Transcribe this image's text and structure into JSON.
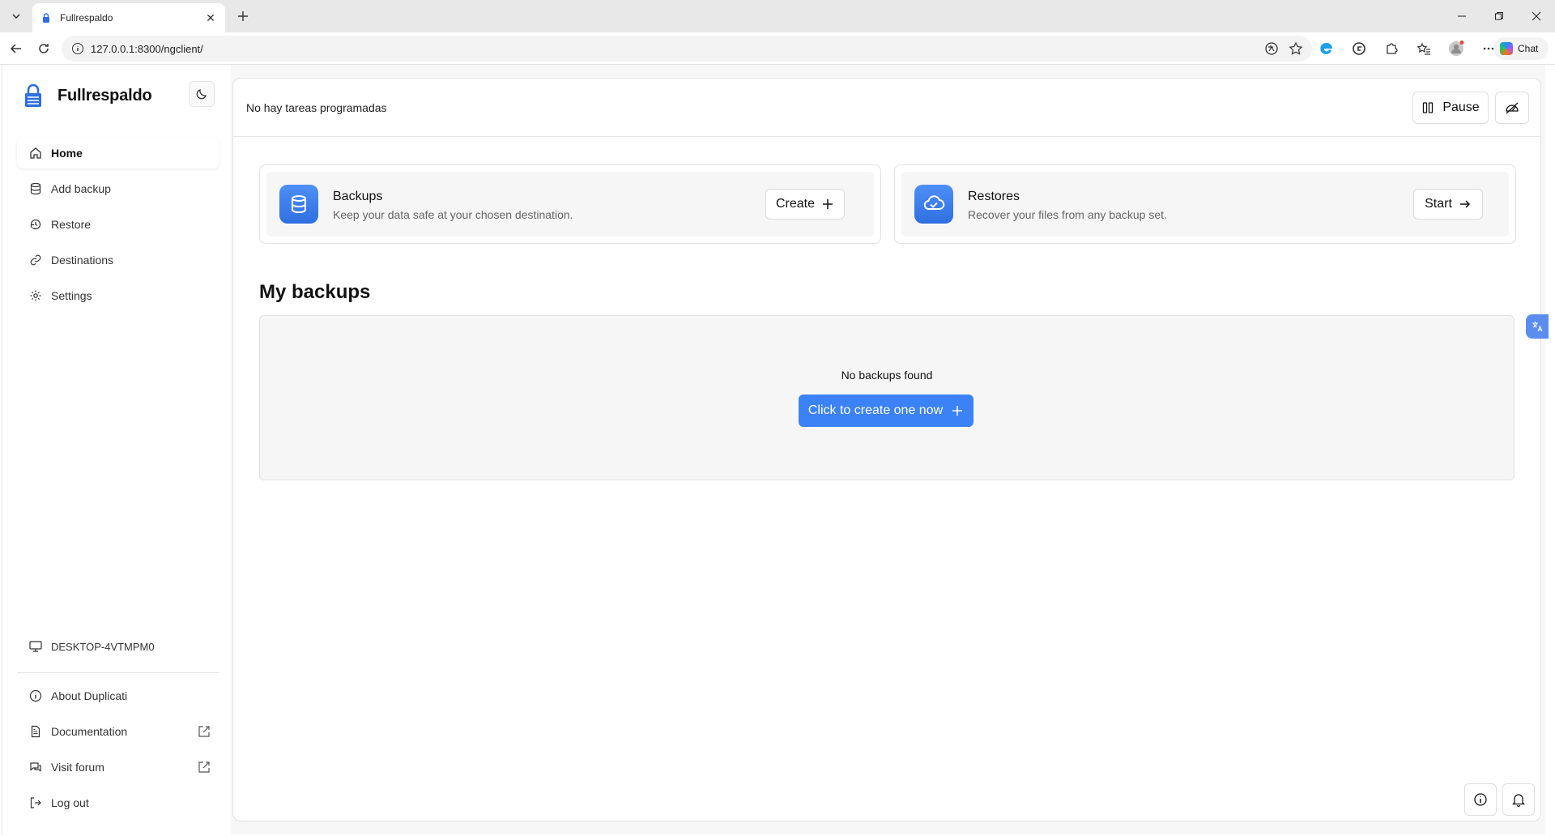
{
  "browser": {
    "tab_title": "Fullrespaldo",
    "url": "127.0.0.1:8300/ngclient/",
    "chat_label": "Chat"
  },
  "sidebar": {
    "brand": "Fullrespaldo",
    "items": [
      {
        "label": "Home",
        "icon": "home-icon"
      },
      {
        "label": "Add backup",
        "icon": "database-icon"
      },
      {
        "label": "Restore",
        "icon": "history-icon"
      },
      {
        "label": "Destinations",
        "icon": "link-icon"
      },
      {
        "label": "Settings",
        "icon": "gear-icon"
      }
    ],
    "machine_name": "DESKTOP-4VTMPM0",
    "bottom_items": [
      {
        "label": "About Duplicati",
        "icon": "info-icon"
      },
      {
        "label": "Documentation",
        "icon": "document-icon"
      },
      {
        "label": "Visit forum",
        "icon": "chat-icon"
      },
      {
        "label": "Log out",
        "icon": "logout-icon"
      }
    ]
  },
  "topbar": {
    "schedule_status": "No hay tareas programadas",
    "pause_label": "Pause"
  },
  "cards": {
    "backups": {
      "title": "Backups",
      "subtitle": "Keep your data safe at your chosen destination.",
      "button_label": "Create"
    },
    "restores": {
      "title": "Restores",
      "subtitle": "Recover your files from any backup set.",
      "button_label": "Start"
    }
  },
  "my_backups": {
    "title": "My backups",
    "empty_text": "No backups found",
    "create_label": "Click to create one now"
  },
  "colors": {
    "accent": "#3b82f6",
    "brand_icon": "#2f6fe0"
  }
}
